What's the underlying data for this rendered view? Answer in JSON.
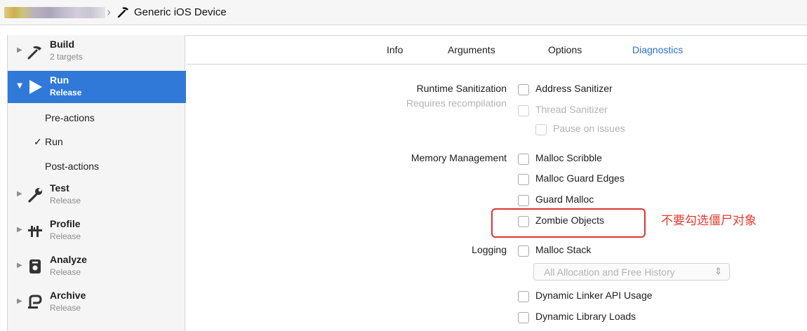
{
  "breadcrumb": {
    "device": "Generic iOS Device"
  },
  "sidebar": {
    "items": [
      {
        "name": "Build",
        "subtitle": "2 targets"
      },
      {
        "name": "Run",
        "subtitle": "Release"
      },
      {
        "name": "Test",
        "subtitle": "Release"
      },
      {
        "name": "Profile",
        "subtitle": "Release"
      },
      {
        "name": "Analyze",
        "subtitle": "Release"
      },
      {
        "name": "Archive",
        "subtitle": "Release"
      }
    ],
    "run_children": [
      "Pre-actions",
      "Run",
      "Post-actions"
    ],
    "run_checkmark": "✓",
    "selected": "Run"
  },
  "tabs": [
    {
      "label": "Info"
    },
    {
      "label": "Arguments"
    },
    {
      "label": "Options"
    },
    {
      "label": "Diagnostics",
      "active": true
    }
  ],
  "diagnostics": {
    "runtime_sanitization": {
      "label": "Runtime Sanitization",
      "sublabel": "Requires recompilation",
      "address_sanitizer": {
        "label": "Address Sanitizer",
        "checked": false
      },
      "thread_sanitizer": {
        "label": "Thread Sanitizer",
        "checked": false,
        "enabled": false
      },
      "pause_on_issues": {
        "label": "Pause on issues",
        "checked": false,
        "enabled": false
      }
    },
    "memory_management": {
      "label": "Memory Management",
      "malloc_scribble": {
        "label": "Malloc Scribble",
        "checked": false
      },
      "malloc_guard_edges": {
        "label": "Malloc Guard Edges",
        "checked": false
      },
      "guard_malloc": {
        "label": "Guard Malloc",
        "checked": false
      },
      "zombie_objects": {
        "label": "Zombie Objects",
        "checked": false
      }
    },
    "logging": {
      "label": "Logging",
      "malloc_stack": {
        "label": "Malloc Stack",
        "checked": false
      },
      "malloc_stack_mode": "All Allocation and Free History",
      "dynamic_linker_api_usage": {
        "label": "Dynamic Linker API Usage",
        "checked": false
      },
      "dynamic_library_loads": {
        "label": "Dynamic Library Loads",
        "checked": false
      }
    }
  },
  "annotation": {
    "text": "不要勾选僵尸对象",
    "color": "#e33b2f"
  },
  "colors": {
    "accent": "#3079d8",
    "tab_active": "#2d6fd6",
    "annotation_box": "#e03232"
  },
  "icons": {
    "breadcrumb": "hammer-icon",
    "build": "hammer-icon",
    "run": "play-icon",
    "test": "wrench-icon",
    "profile": "instruments-icon",
    "analyze": "analyze-icon",
    "archive": "archive-icon"
  }
}
